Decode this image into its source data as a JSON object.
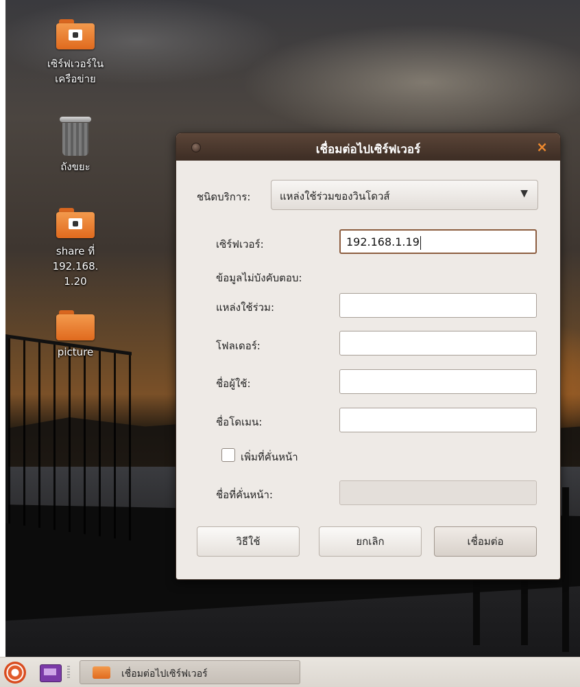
{
  "desktop": {
    "icons": [
      {
        "label_line1": "เซิร์ฟเวอร์ใน",
        "label_line2": "เครือข่าย",
        "icon": "network-folder-icon"
      },
      {
        "label_line1": "ถังขยะ",
        "icon": "trash-icon"
      },
      {
        "label_line1": "share ที่ 192.168.",
        "label_line2": "1.20",
        "icon": "share-folder-icon"
      },
      {
        "label_line1": "picture",
        "icon": "folder-icon"
      }
    ]
  },
  "dialog": {
    "title": "เชื่อมต่อไปเซิร์ฟเวอร์",
    "close_glyph": "×",
    "service_type": {
      "label": "ชนิดบริการ:",
      "value": "แหล่งใช้ร่วมของวินโดวส์",
      "arrow": "▼"
    },
    "server": {
      "label": "เซิร์ฟเวอร์:",
      "value": "192.168.1.19"
    },
    "optional_info": "ข้อมูลไม่บังคับตอบ:",
    "share": {
      "label": "แหล่งใช้ร่วม:",
      "value": ""
    },
    "folder": {
      "label": "โฟลเดอร์:",
      "value": ""
    },
    "username": {
      "label": "ชื่อผู้ใช้:",
      "value": ""
    },
    "domain": {
      "label": "ชื่อโดเมน:",
      "value": ""
    },
    "add_bookmark": {
      "label": "เพิ่มที่คั่นหน้า",
      "checked": false
    },
    "bookmark_name": {
      "label": "ชื่อที่คั่นหน้า:",
      "value": ""
    },
    "buttons": {
      "help": "วิธีใช้",
      "cancel": "ยกเลิก",
      "connect": "เชื่อมต่อ"
    }
  },
  "taskbar": {
    "task_title": "เชื่อมต่อไปเซิร์ฟเวอร์"
  }
}
